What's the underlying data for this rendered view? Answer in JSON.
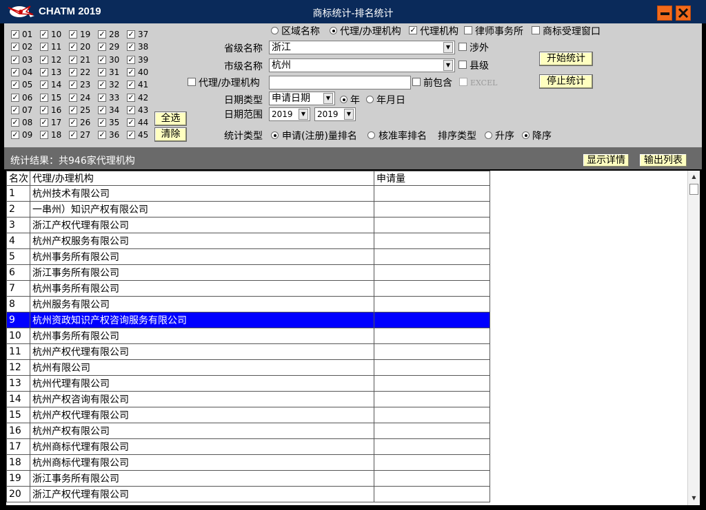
{
  "app": {
    "name": "CHATM 2019",
    "window_title": "商标统计-排名统计"
  },
  "colors": {
    "titlebar": "#0a2a5a",
    "panel": "#cfcfcf",
    "accent_button": "#ffffc0",
    "selected_row": "#0000ff",
    "window_buttons": "#f26a1b"
  },
  "icons": {
    "logo": "eagle-logo-icon",
    "minimize": "minimize-icon",
    "close": "close-icon",
    "check": "checkmark-icon"
  },
  "checkmark": "✓",
  "classes": [
    "01",
    "02",
    "03",
    "04",
    "05",
    "06",
    "07",
    "08",
    "09",
    "10",
    "11",
    "12",
    "13",
    "14",
    "15",
    "16",
    "17",
    "18",
    "19",
    "20",
    "21",
    "22",
    "23",
    "24",
    "25",
    "26",
    "27",
    "28",
    "29",
    "30",
    "31",
    "32",
    "33",
    "34",
    "35",
    "36",
    "37",
    "38",
    "39",
    "40",
    "41",
    "42",
    "43",
    "44",
    "45"
  ],
  "class_buttons": {
    "select_all": "全选",
    "clear": "清除"
  },
  "scope": {
    "options": [
      {
        "label": "区域名称",
        "selected": false
      },
      {
        "label": "代理/办理机构",
        "selected": true
      }
    ],
    "filters": [
      {
        "label": "代理机构",
        "checked": true
      },
      {
        "label": "律师事务所",
        "checked": false
      },
      {
        "label": "商标受理窗口",
        "checked": false
      }
    ]
  },
  "province": {
    "label": "省级名称",
    "value": "浙江",
    "foreign_label": "涉外"
  },
  "city": {
    "label": "市级名称",
    "value": "杭州",
    "county_label": "县级"
  },
  "agency": {
    "label": "代理/办理机构",
    "value": "",
    "prefix_label": "前包含",
    "excel_label": "EXCEL"
  },
  "date_type": {
    "label": "日期类型",
    "value": "申请日期",
    "year_label": "年",
    "year_month_label": "年月日",
    "year_selected": true
  },
  "date_range": {
    "label": "日期范围",
    "from": "2019",
    "to": "2019"
  },
  "stat_type": {
    "label": "统计类型",
    "apply_rank": "申请(注册)量排名",
    "approve_rank": "核准率排名",
    "apply_selected": true
  },
  "sort_type": {
    "label": "排序类型",
    "asc": "升序",
    "desc": "降序",
    "desc_selected": true
  },
  "actions": {
    "start": "开始统计",
    "stop": "停止统计",
    "details": "显示详情",
    "export": "输出列表"
  },
  "result_summary": "统计结果：共946家代理机构",
  "table": {
    "headers": [
      "名次",
      "代理/办理机构",
      "申请量"
    ],
    "selected_rank": "9",
    "rows": [
      {
        "rank": "1",
        "agency": "杭州技术有限公司"
      },
      {
        "rank": "2",
        "agency": "一串州）知识产权有限公司"
      },
      {
        "rank": "3",
        "agency": "浙江产权代理有限公司"
      },
      {
        "rank": "4",
        "agency": "杭州产权服务有限公司"
      },
      {
        "rank": "5",
        "agency": "杭州事务所有限公司"
      },
      {
        "rank": "6",
        "agency": "浙江事务所有限公司"
      },
      {
        "rank": "7",
        "agency": "杭州事务所有限公司"
      },
      {
        "rank": "8",
        "agency": "杭州服务有限公司"
      },
      {
        "rank": "9",
        "agency": "杭州资政知识产权咨询服务有限公司"
      },
      {
        "rank": "10",
        "agency": "杭州事务所有限公司"
      },
      {
        "rank": "11",
        "agency": "杭州产权代理有限公司"
      },
      {
        "rank": "12",
        "agency": "杭州有限公司"
      },
      {
        "rank": "13",
        "agency": "杭州代理有限公司"
      },
      {
        "rank": "14",
        "agency": "杭州产权咨询有限公司"
      },
      {
        "rank": "15",
        "agency": "杭州产权代理有限公司"
      },
      {
        "rank": "16",
        "agency": "杭州产权有限公司"
      },
      {
        "rank": "17",
        "agency": "杭州商标代理有限公司"
      },
      {
        "rank": "18",
        "agency": "杭州商标代理有限公司"
      },
      {
        "rank": "19",
        "agency": "浙江事务所有限公司"
      },
      {
        "rank": "20",
        "agency": "浙江产权代理有限公司"
      }
    ]
  }
}
